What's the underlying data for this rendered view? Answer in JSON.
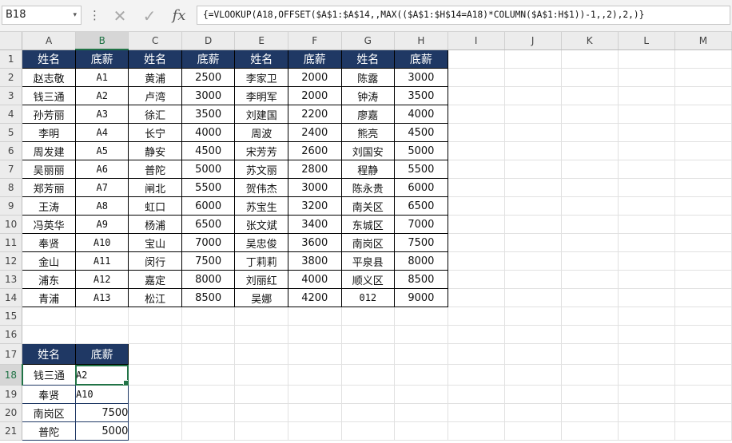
{
  "name_box": {
    "value": "B18",
    "arrow": "▾"
  },
  "formula_bar": {
    "menu_dots": "⋮",
    "cancel_icon": "✕",
    "enter_icon": "✓",
    "fx_label": "fx",
    "formula": "{=VLOOKUP(A18,OFFSET($A$1:$A$14,,MAX(($A$1:$H$14=A18)*COLUMN($A$1:H$1))-1,,2),2,)}"
  },
  "columns": [
    "A",
    "B",
    "C",
    "D",
    "E",
    "F",
    "G",
    "H",
    "I",
    "J",
    "K",
    "L",
    "M"
  ],
  "header_row": [
    "姓名",
    "底薪",
    "姓名",
    "底薪",
    "姓名",
    "底薪",
    "姓名",
    "底薪"
  ],
  "table_rows": [
    [
      "赵志敬",
      "A1",
      "黄浦",
      "2500",
      "李家卫",
      "2000",
      "陈露",
      "3000"
    ],
    [
      "钱三通",
      "A2",
      "卢湾",
      "3000",
      "李明军",
      "2000",
      "钟涛",
      "3500"
    ],
    [
      "孙芳丽",
      "A3",
      "徐汇",
      "3500",
      "刘建国",
      "2200",
      "廖嘉",
      "4000"
    ],
    [
      "李明",
      "A4",
      "长宁",
      "4000",
      "周波",
      "2400",
      "熊亮",
      "4500"
    ],
    [
      "周发建",
      "A5",
      "静安",
      "4500",
      "宋芳芳",
      "2600",
      "刘国安",
      "5000"
    ],
    [
      "吴丽丽",
      "A6",
      "普陀",
      "5000",
      "苏文丽",
      "2800",
      "程静",
      "5500"
    ],
    [
      "郑芳丽",
      "A7",
      "闸北",
      "5500",
      "贺伟杰",
      "3000",
      "陈永贵",
      "6000"
    ],
    [
      "王涛",
      "A8",
      "虹口",
      "6000",
      "苏宝生",
      "3200",
      "南关区",
      "6500"
    ],
    [
      "冯英华",
      "A9",
      "杨浦",
      "6500",
      "张文斌",
      "3400",
      "东城区",
      "7000"
    ],
    [
      "奉贤",
      "A10",
      "宝山",
      "7000",
      "吴忠俊",
      "3600",
      "南岗区",
      "7500"
    ],
    [
      "金山",
      "A11",
      "闵行",
      "7500",
      "丁莉莉",
      "3800",
      "平泉县",
      "8000"
    ],
    [
      "浦东",
      "A12",
      "嘉定",
      "8000",
      "刘丽红",
      "4000",
      "顺义区",
      "8500"
    ],
    [
      "青浦",
      "A13",
      "松江",
      "8500",
      "吴娜",
      "4200",
      "012",
      "9000"
    ]
  ],
  "lookup_header": [
    "姓名",
    "底薪"
  ],
  "lookup_rows": [
    [
      "钱三通",
      "A2"
    ],
    [
      "奉贤",
      "A10"
    ],
    [
      "南岗区",
      "7500"
    ],
    [
      "普陀",
      "5000"
    ]
  ]
}
